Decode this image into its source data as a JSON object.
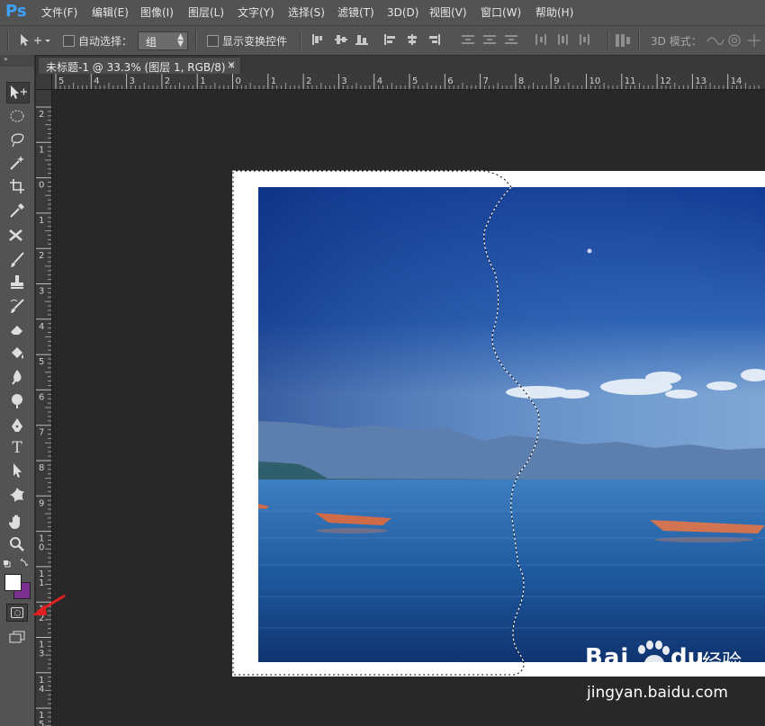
{
  "app": {
    "logo": "Ps"
  },
  "menu": [
    "文件(F)",
    "编辑(E)",
    "图像(I)",
    "图层(L)",
    "文字(Y)",
    "选择(S)",
    "滤镜(T)",
    "3D(D)",
    "视图(V)",
    "窗口(W)",
    "帮助(H)"
  ],
  "options": {
    "auto_select_label": "自动选择：",
    "auto_select_value": "组",
    "show_transform_label": "显示变换控件",
    "mode_3d_label": "3D 模式："
  },
  "document": {
    "tab_title": "未标题-1 @ 33.3% (图层 1, RGB/8) *",
    "close": "×"
  },
  "ruler": {
    "h_ticks": [
      "5",
      "4",
      "3",
      "2",
      "1",
      "0",
      "1",
      "2",
      "3",
      "4",
      "5",
      "6",
      "7",
      "8",
      "9",
      "10",
      "11",
      "12",
      "13",
      "14"
    ],
    "v_ticks": [
      "2",
      "1",
      "0",
      "1",
      "2",
      "3",
      "4",
      "5",
      "6",
      "7",
      "8",
      "9",
      "10",
      "11",
      "12",
      "13",
      "14",
      "15"
    ]
  },
  "colors": {
    "foreground": "#ffffff",
    "background": "#7b2f8e",
    "ps_blue": "#3ba3ff",
    "annotation": "#e02020"
  },
  "tools": [
    "move-tool",
    "marquee-tool",
    "lasso-tool",
    "magic-wand-tool",
    "crop-tool",
    "eyedropper-tool",
    "healing-tool",
    "brush-tool",
    "stamp-tool",
    "history-brush-tool",
    "eraser-tool",
    "paint-bucket-tool",
    "blur-tool",
    "dodge-tool",
    "pen-tool",
    "type-tool",
    "path-select-tool",
    "shape-tool",
    "hand-tool",
    "zoom-tool"
  ],
  "tool_glyphs": {
    "type": "T"
  },
  "watermark": {
    "brand": "Bai",
    "brand2": "du",
    "cn": "经验",
    "url": "jingyan.baidu.com"
  }
}
